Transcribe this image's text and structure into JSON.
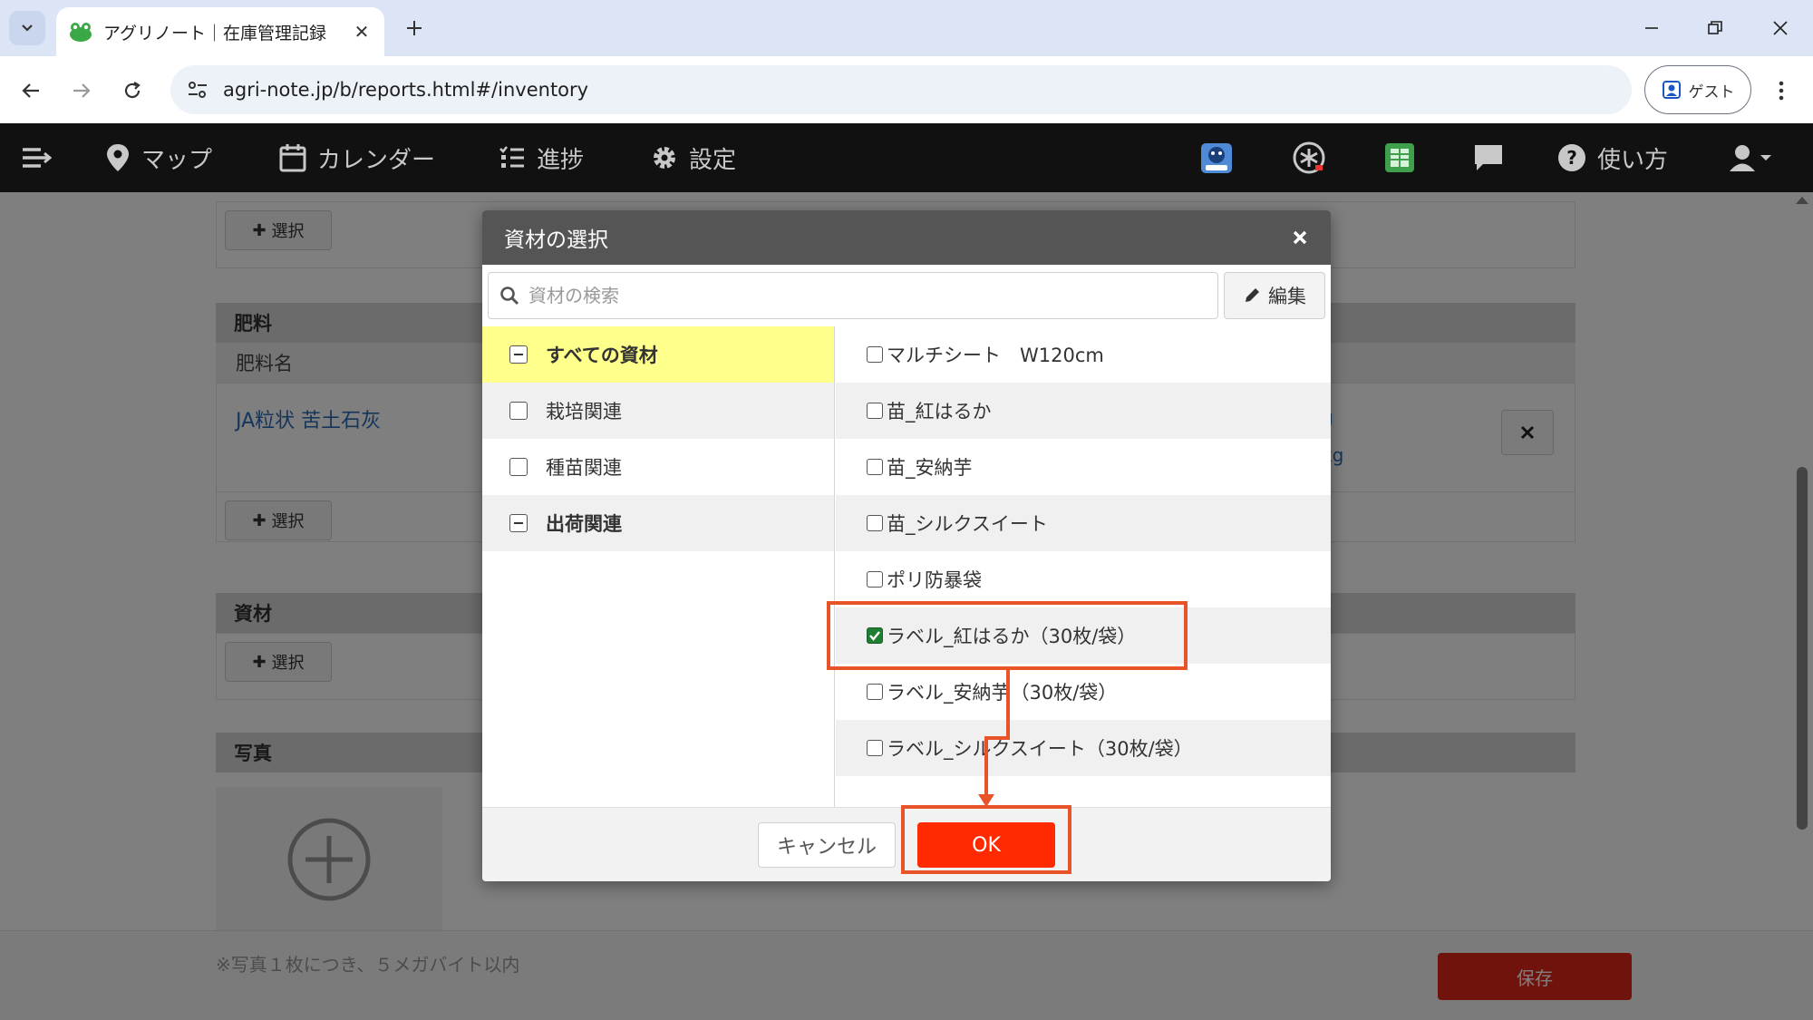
{
  "browser": {
    "tab_title": "アグリノート｜在庫管理記録",
    "url": "agri-note.jp/b/reports.html#/inventory",
    "profile_label": "ゲスト"
  },
  "appnav": {
    "items": [
      {
        "label": "マップ",
        "icon": "map-pin-icon"
      },
      {
        "label": "カレンダー",
        "icon": "calendar-icon"
      },
      {
        "label": "進捗",
        "icon": "progress-list-icon"
      },
      {
        "label": "設定",
        "icon": "gear-icon"
      }
    ],
    "help_label": "使い方"
  },
  "page": {
    "select_label": "選択",
    "fertilizer_header": "肥料",
    "fertilizer_col": "肥料名",
    "fertilizer_item": "JA粒状 苦土石灰",
    "partial_unit_1": "g",
    "partial_unit_2": "kg",
    "material_header": "資材",
    "photo_header": "写真",
    "photo_note": "※写真１枚につき、５メガバイト以内",
    "save_label": "保存"
  },
  "modal": {
    "title": "資材の選択",
    "search_placeholder": "資材の検索",
    "edit_label": "編集",
    "categories": [
      {
        "label": "すべての資材",
        "state": "indeterminate"
      },
      {
        "label": "栽培関連",
        "state": "unchecked"
      },
      {
        "label": "種苗関連",
        "state": "unchecked"
      },
      {
        "label": "出荷関連",
        "state": "indeterminate"
      }
    ],
    "items": [
      {
        "label": "マルチシート　W120cm",
        "checked": false
      },
      {
        "label": "苗_紅はるか",
        "checked": false
      },
      {
        "label": "苗_安納芋",
        "checked": false
      },
      {
        "label": "苗_シルクスイート",
        "checked": false
      },
      {
        "label": "ポリ防暴袋",
        "checked": false
      },
      {
        "label": "ラベル_紅はるか（30枚/袋）",
        "checked": true
      },
      {
        "label": "ラベル_安納芋（30枚/袋）",
        "checked": false
      },
      {
        "label": "ラベル_シルクスイート（30枚/袋）",
        "checked": false
      }
    ],
    "cancel_label": "キャンセル",
    "ok_label": "OK"
  },
  "colors": {
    "accent_red": "#ff2a00",
    "highlight_yellow": "#ffff8c",
    "annotation_orange": "#e8532a",
    "nav_bg": "#111111"
  }
}
